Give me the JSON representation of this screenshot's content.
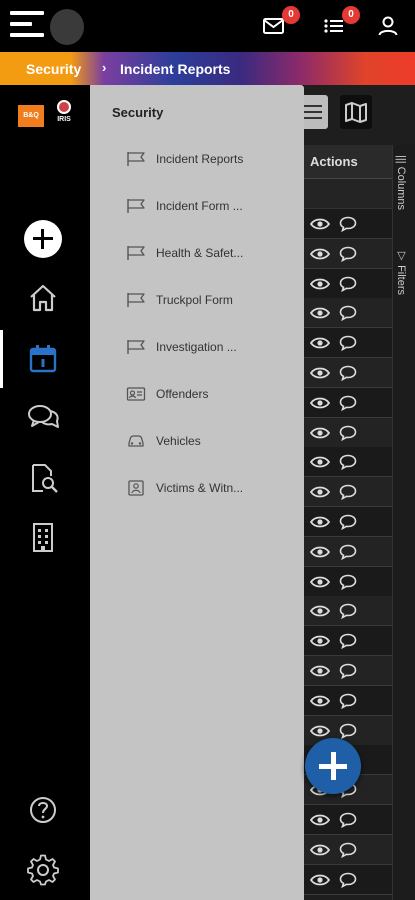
{
  "header": {
    "mail_badge": "0",
    "tasks_badge": "0"
  },
  "breadcrumb": {
    "section": "Security",
    "current": "Incident Reports"
  },
  "brand": {
    "logo1": "B&Q",
    "logo2": "IRIS"
  },
  "rail": {
    "icons": [
      "add-icon",
      "home-icon",
      "calendar-icon",
      "chat-icon",
      "document-search-icon",
      "building-icon",
      "help-icon",
      "settings-icon"
    ]
  },
  "flyout": {
    "title": "Security",
    "items": [
      {
        "label": "Incident Reports",
        "icon": "flag-icon"
      },
      {
        "label": "Incident Form ...",
        "icon": "flag-icon"
      },
      {
        "label": "Health & Safet...",
        "icon": "flag-icon"
      },
      {
        "label": "Truckpol Form",
        "icon": "flag-icon"
      },
      {
        "label": "Investigation ...",
        "icon": "flag-icon"
      },
      {
        "label": "Offenders",
        "icon": "id-card-icon"
      },
      {
        "label": "Vehicles",
        "icon": "car-icon"
      },
      {
        "label": "Victims & Witn...",
        "icon": "person-badge-icon"
      }
    ]
  },
  "grid": {
    "actions_header": "Actions",
    "side_tabs": [
      "Columns",
      "Filters"
    ],
    "row_count": 23
  },
  "colors": {
    "accent_blue": "#1f5fa8",
    "badge_red": "#e53935",
    "flyout_bg": "#c4c4c4"
  }
}
